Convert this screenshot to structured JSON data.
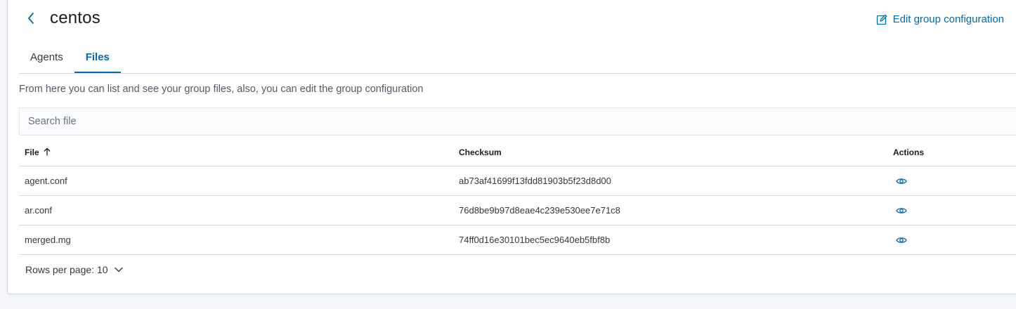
{
  "header": {
    "title": "centos",
    "back_icon": "chevron-left-icon",
    "edit_label": "Edit group configuration",
    "edit_icon": "edit-icon"
  },
  "tabs": [
    {
      "label": "Agents",
      "active": false
    },
    {
      "label": "Files",
      "active": true
    }
  ],
  "description": "From here you can list and see your group files, also, you can edit the group configuration",
  "search": {
    "placeholder": "Search file",
    "value": ""
  },
  "table": {
    "columns": {
      "file": "File",
      "checksum": "Checksum",
      "actions": "Actions"
    },
    "sort_icon": "arrow-up-icon",
    "rows": [
      {
        "file": "agent.conf",
        "checksum": "ab73af41699f13fdd81903b5f23d8d00",
        "action_icon": "eye-icon"
      },
      {
        "file": "ar.conf",
        "checksum": "76d8be9b97d8eae4c239e530ee7e71c8",
        "action_icon": "eye-icon"
      },
      {
        "file": "merged.mg",
        "checksum": "74ff0d16e30101bec5ec9640eb5fbf8b",
        "action_icon": "eye-icon"
      }
    ]
  },
  "pagination": {
    "rows_per_page_label": "Rows per page: 10"
  },
  "colors": {
    "accent": "#006bb4",
    "border": "#d3dae6",
    "text": "#343741"
  }
}
